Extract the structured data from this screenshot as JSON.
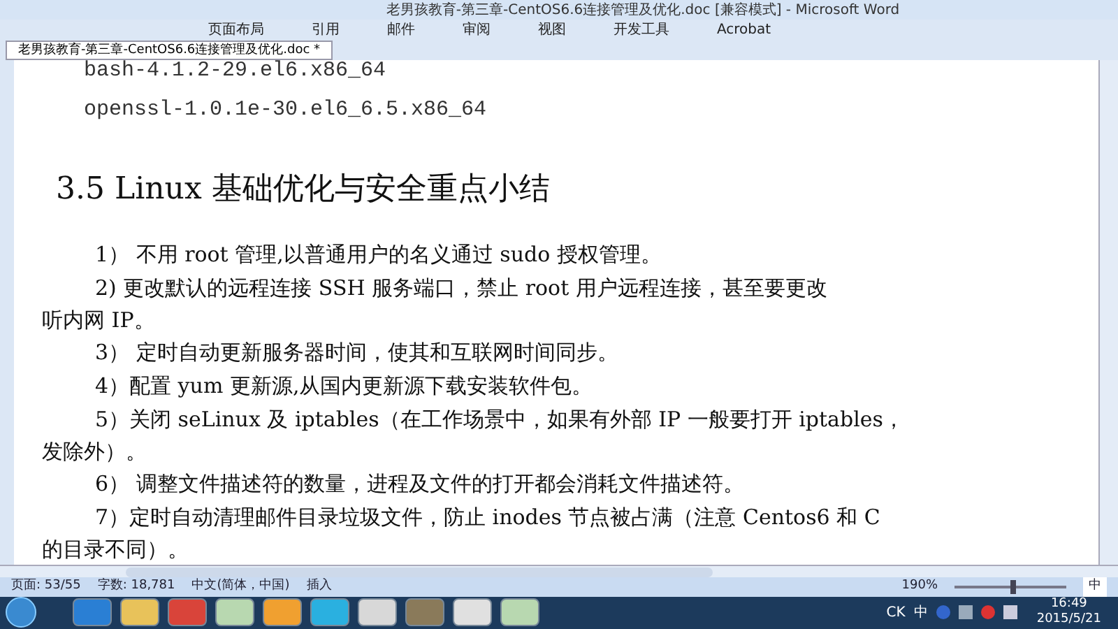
{
  "window": {
    "title": "老男孩教育-第三章-CentOS6.6连接管理及优化.doc [兼容模式] - Microsoft Word"
  },
  "ribbon_tabs": [
    {
      "label": "页面布局",
      "selected": false
    },
    {
      "label": "引用",
      "selected": false
    },
    {
      "label": "邮件",
      "selected": false
    },
    {
      "label": "审阅",
      "selected": false
    },
    {
      "label": "视图",
      "selected": false
    },
    {
      "label": "开发工具",
      "selected": false
    },
    {
      "label": "Acrobat",
      "selected": false
    }
  ],
  "document_tab": {
    "label": "老男孩教育-第三章-CentOS6.6连接管理及优化.doc *"
  },
  "document": {
    "code_lines": [
      "bash-4.1.2-29.el6.x86_64",
      "openssl-1.0.1e-30.el6_6.5.x86_64"
    ],
    "heading": "3.5 Linux 基础优化与安全重点小结",
    "paragraphs": [
      {
        "first": "1） 不用 root 管理,以普通用户的名义通过 sudo 授权管理。"
      },
      {
        "first": "2) 更改默认的远程连接 SSH 服务端口，禁止 root 用户远程连接，甚至要更改",
        "rest": "听内网 IP。"
      },
      {
        "first": "3） 定时自动更新服务器时间，使其和互联网时间同步。"
      },
      {
        "first": "4）配置 yum 更新源,从国内更新源下载安装软件包。"
      },
      {
        "first": "5）关闭 seLinux 及 iptables（在工作场景中，如果有外部 IP 一般要打开 iptables，",
        "rest": "发除外）。"
      },
      {
        "first": "6） 调整文件描述符的数量，进程及文件的打开都会消耗文件描述符。"
      },
      {
        "first": "7）定时自动清理邮件目录垃圾文件，防止 inodes 节点被占满（注意 Centos6 和 C",
        "rest": "的目录不同）。"
      }
    ]
  },
  "status_bar": {
    "page": "页面: 53/55",
    "words": "字数: 18,781",
    "language": "中文(简体，中国)",
    "mode": "插入",
    "zoom": "190%",
    "zoom_slider": {
      "level": 0.5
    },
    "ime": "中"
  },
  "taskbar": {
    "tray": [
      "CK",
      "中"
    ],
    "time": "16:49",
    "date": "2015/5/21"
  }
}
